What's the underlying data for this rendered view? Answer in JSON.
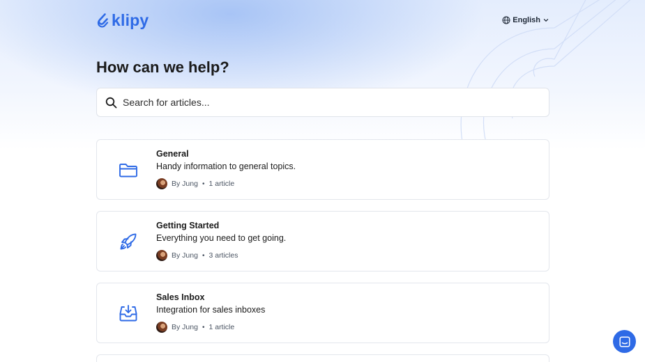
{
  "brand": {
    "name": "klipy",
    "color": "#2e6ae6"
  },
  "language": {
    "selected": "English",
    "icon": "globe-icon"
  },
  "page": {
    "title": "How can we help?"
  },
  "search": {
    "placeholder": "Search for articles...",
    "value": ""
  },
  "collections": [
    {
      "icon": "folder-icon",
      "title": "General",
      "description": "Handy information to general topics.",
      "author": "By Jung",
      "count": "1 article"
    },
    {
      "icon": "rocket-icon",
      "title": "Getting Started",
      "description": "Everything you need to get going.",
      "author": "By Jung",
      "count": "3 articles"
    },
    {
      "icon": "inbox-icon",
      "title": "Sales Inbox",
      "description": "Integration for sales inboxes",
      "author": "By Jung",
      "count": "1 article"
    }
  ],
  "chat": {
    "icon": "chat-icon"
  },
  "colors": {
    "accent": "#2e6ae6",
    "hero": "#93b6f3"
  }
}
